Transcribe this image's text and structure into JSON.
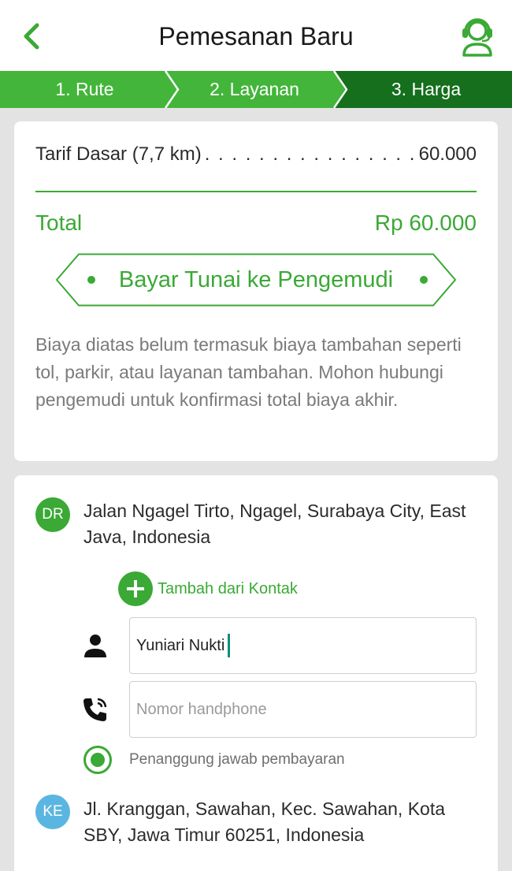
{
  "header": {
    "title": "Pemesanan Baru",
    "back_icon": "chevron-left-icon",
    "support_icon": "customer-support-icon"
  },
  "steps": [
    {
      "label": "1. Rute",
      "state": "done"
    },
    {
      "label": "2. Layanan",
      "state": "done"
    },
    {
      "label": "3. Harga",
      "state": "active"
    }
  ],
  "colors": {
    "accent": "#3aa935",
    "accent_dark": "#156f1c",
    "step_done": "#43b53a",
    "dest_badge": "#5ab6e0"
  },
  "fare": {
    "base_label": "Tarif Dasar (7,7 km)",
    "base_value": "60.000",
    "total_label": "Total",
    "total_value": "Rp 60.000",
    "payment_method": "Bayar Tunai ke Pengemudi",
    "note": "Biaya diatas belum termasuk biaya tambahan seperti tol, parkir, atau layanan tambahan. Mohon hubungi pengemudi untuk konfirmasi total biaya akhir."
  },
  "origin": {
    "badge": "DR",
    "address": "Jalan Ngagel Tirto, Ngagel, Surabaya City, East Java, Indonesia",
    "add_contact_label": "Tambah dari Kontak",
    "name_value": "Yuniari Nukti",
    "phone_placeholder": "Nomor handphone",
    "payer_label": "Penanggung jawab pembayaran",
    "payer_selected": true
  },
  "destination": {
    "badge": "KE",
    "address": "Jl. Kranggan, Sawahan, Kec. Sawahan, Kota SBY, Jawa Timur 60251, Indonesia"
  }
}
